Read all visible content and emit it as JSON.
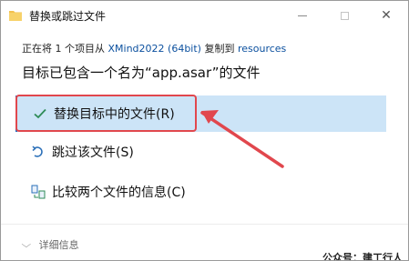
{
  "window": {
    "title": "替换或跳过文件",
    "minimize_icon": "minimize-icon",
    "maximize_icon": "maximize-icon",
    "close_icon": "close-icon"
  },
  "copy_info": {
    "prefix": "正在将 1 个项目从 ",
    "source": "XMind2022 (64bit)",
    "middle": " 复制到 ",
    "destination": "resources"
  },
  "headline": "目标已包含一个名为“app.asar”的文件",
  "options": [
    {
      "label": "替换目标中的文件(R)",
      "icon": "checkmark-icon",
      "selected": true
    },
    {
      "label": "跳过该文件(S)",
      "icon": "skip-icon",
      "selected": false
    },
    {
      "label": "比较两个文件的信息(C)",
      "icon": "compare-icon",
      "selected": false
    }
  ],
  "footer": {
    "details_label": "详细信息",
    "details_icon": "chevron-down-icon"
  },
  "watermark": "公众号：建工行人",
  "colors": {
    "selected_bg": "#cce4f7",
    "link": "#0a4f9e",
    "annotation_red": "#e1474d",
    "check_green": "#2e8b57"
  }
}
